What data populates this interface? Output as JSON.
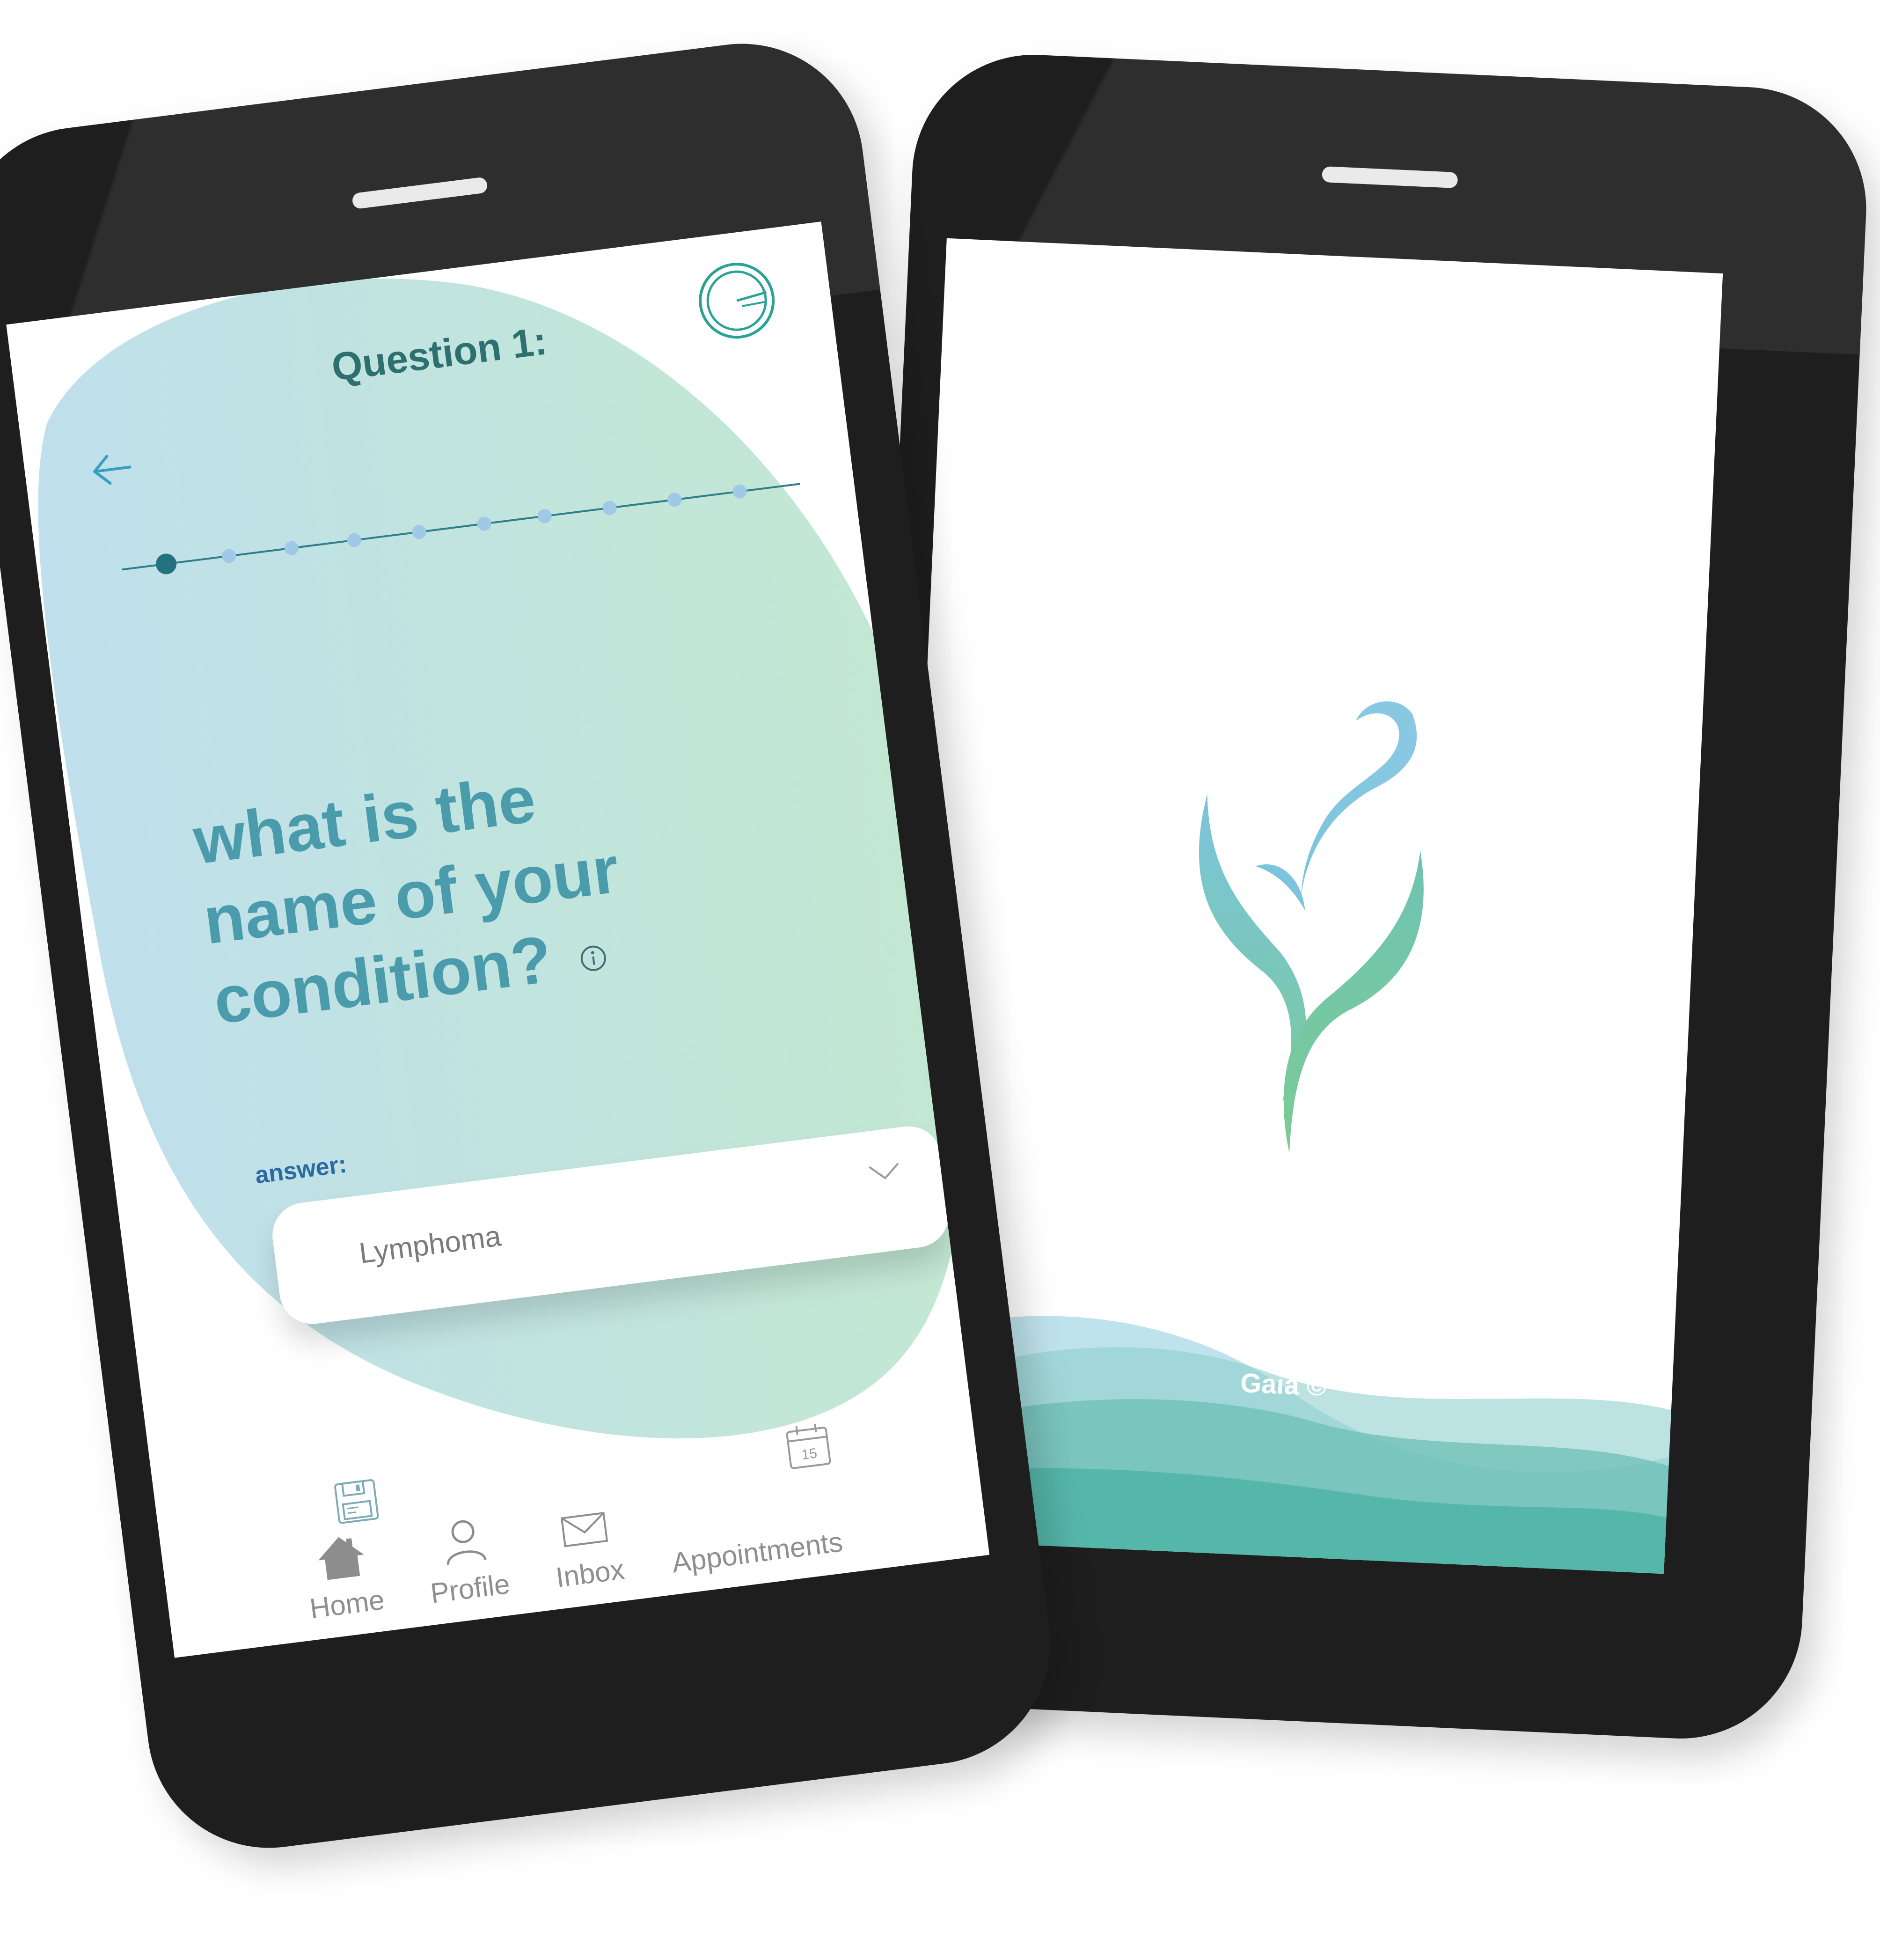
{
  "left_screen": {
    "title": "Question 1:",
    "progress": {
      "current": 1,
      "total": 10
    },
    "question": "what is the name of your condition?",
    "answer_label": "answer:",
    "answer_value": "Lymphoma",
    "icons": {
      "back": "back-arrow-icon",
      "timer": "timer-icon",
      "info": "info-icon",
      "dropdown": "chevron-down-icon",
      "save": "save-icon",
      "calendar": "calendar-icon"
    },
    "calendar_day": "15",
    "nav": [
      {
        "label": "Home",
        "icon": "home-icon"
      },
      {
        "label": "Profile",
        "icon": "profile-icon"
      },
      {
        "label": "Inbox",
        "icon": "inbox-icon"
      },
      {
        "label": "Appointments",
        "icon": "calendar-icon"
      }
    ]
  },
  "right_screen": {
    "brand": "Gaia ©",
    "logo": "leaf-logo-icon"
  },
  "colors": {
    "phone_body": "#1e1e1e",
    "accent_blue": "#7cc4dd",
    "accent_green": "#7ccb95",
    "teal_title": "#2e6f70",
    "question_text": "#4a9bab",
    "answer_label": "#2b6aa2",
    "nav_text": "#8f8f8f"
  }
}
